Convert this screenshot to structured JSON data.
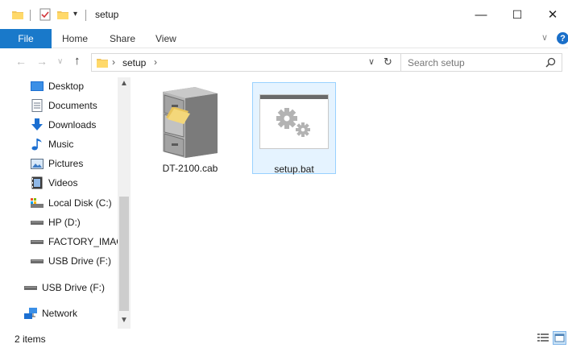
{
  "window": {
    "title": "setup"
  },
  "title_controls": {
    "minimize": "—",
    "maximize": "☐",
    "close": "✕"
  },
  "ribbon": {
    "tabs": [
      {
        "label": "File",
        "active": true
      },
      {
        "label": "Home"
      },
      {
        "label": "Share"
      },
      {
        "label": "View"
      }
    ],
    "help_label": "?"
  },
  "address": {
    "crumb": "setup",
    "search_placeholder": "Search setup"
  },
  "nav_pane": {
    "items": [
      {
        "label": "Desktop",
        "icon": "desktop-icon"
      },
      {
        "label": "Documents",
        "icon": "documents-icon"
      },
      {
        "label": "Downloads",
        "icon": "downloads-icon"
      },
      {
        "label": "Music",
        "icon": "music-icon"
      },
      {
        "label": "Pictures",
        "icon": "pictures-icon"
      },
      {
        "label": "Videos",
        "icon": "videos-icon"
      },
      {
        "label": "Local Disk (C:)",
        "icon": "local-disk-icon"
      },
      {
        "label": "HP (D:)",
        "icon": "drive-icon"
      },
      {
        "label": "FACTORY_IMAG",
        "icon": "drive-icon"
      },
      {
        "label": "USB Drive (F:)",
        "icon": "usb-drive-icon"
      },
      {
        "label": "USB Drive (F:)",
        "icon": "usb-drive-icon"
      },
      {
        "label": "Network",
        "icon": "network-icon"
      }
    ]
  },
  "files": [
    {
      "name": "DT-2100.cab",
      "icon": "cabinet-file-icon",
      "selected": false
    },
    {
      "name": "setup.bat",
      "icon": "batch-file-icon",
      "selected": true
    }
  ],
  "status": {
    "items_count": "2 items"
  },
  "colors": {
    "accent": "#1979ca",
    "selection_bg": "#e5f3ff",
    "selection_border": "#99d1ff"
  }
}
